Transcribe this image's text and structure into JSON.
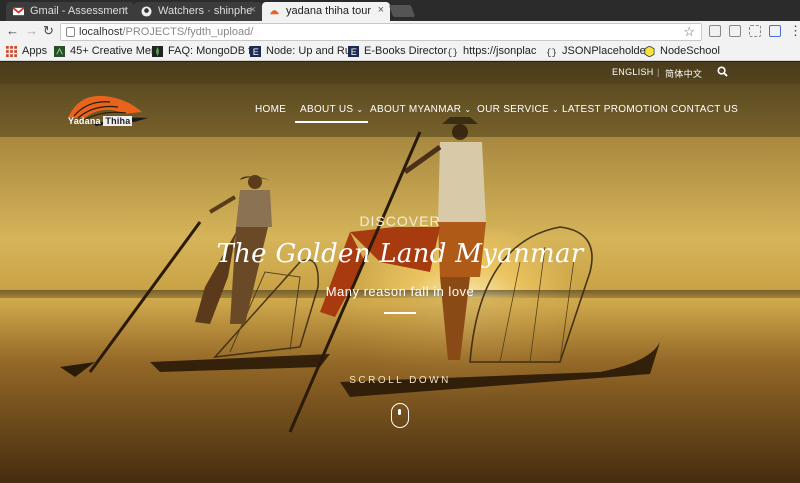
{
  "browser": {
    "tabs": [
      {
        "title": "Gmail - Assessment",
        "icon": "gmail-icon"
      },
      {
        "title": "Watchers · shinphe",
        "icon": "github-icon"
      },
      {
        "title": "yadana thiha tour",
        "icon": "site-favicon"
      }
    ],
    "close_glyph": "×",
    "url_host": "localhost",
    "url_path": "/PROJECTS/fydth_upload/",
    "bookmarks": [
      {
        "label": "Apps",
        "icon": "apps-grid-icon"
      },
      {
        "label": "45+ Creative Mer",
        "icon": "bookmark-icon"
      },
      {
        "label": "FAQ: MongoDB f",
        "icon": "mongodb-icon"
      },
      {
        "label": "Node: Up and Ru",
        "icon": "book-e-icon"
      },
      {
        "label": "E-Books Director",
        "icon": "book-e-icon"
      },
      {
        "label": "https://jsonplac",
        "icon": "json-icon"
      },
      {
        "label": "JSONPlaceholde",
        "icon": "json-icon"
      },
      {
        "label": "NodeSchool",
        "icon": "nodeschool-icon"
      }
    ]
  },
  "site": {
    "lang_en": "ENGLISH",
    "lang_sep": "|",
    "lang_zh": "简体中文",
    "logo": {
      "word1": "Yadana",
      "word2": "Thiha"
    },
    "nav": [
      {
        "label": "HOME",
        "dropdown": false
      },
      {
        "label": "ABOUT US",
        "dropdown": true
      },
      {
        "label": "ABOUT MYANMAR",
        "dropdown": true
      },
      {
        "label": "OUR SERVICE",
        "dropdown": true
      },
      {
        "label": "LATEST PROMOTION",
        "dropdown": false
      },
      {
        "label": "CONTACT US",
        "dropdown": false
      }
    ],
    "caret": "⌄",
    "hero": {
      "discover": "DISCOVER",
      "title": "The Golden Land Myanmar",
      "subtitle": "Many reason fall in love",
      "scroll": "SCROLL DOWN"
    },
    "colors": {
      "logo_orange": "#e8641c",
      "hero_gold": "#d6b45a"
    }
  }
}
